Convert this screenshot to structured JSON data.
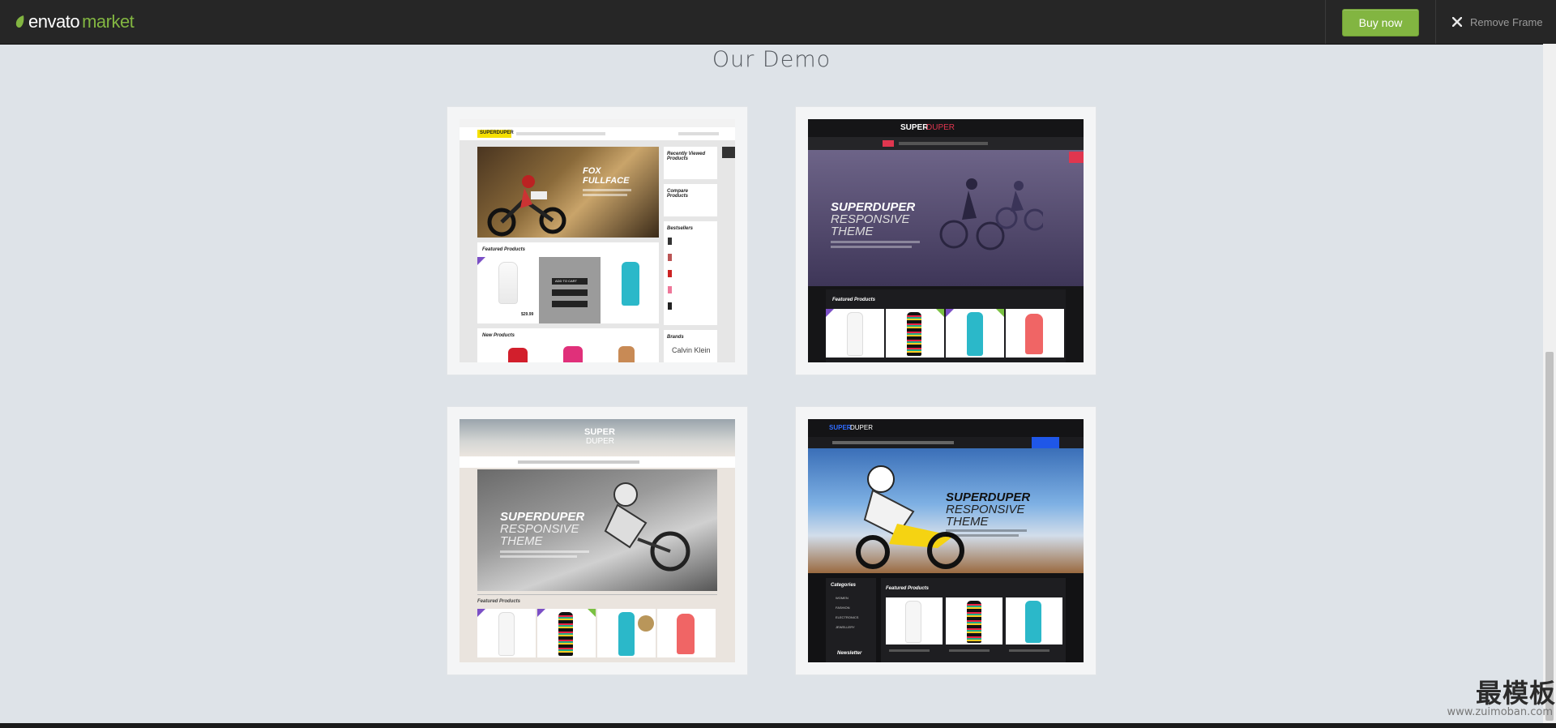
{
  "topbar": {
    "logo_part1": "envato",
    "logo_part2": "market",
    "buy_label": "Buy now",
    "remove_label": "Remove Frame"
  },
  "page": {
    "heading": "Our Demo"
  },
  "demos": [
    {
      "brand": "SUPERDUPER",
      "hero_title_1": "FOX",
      "hero_title_2": "FULLFACE",
      "recently_viewed": "Recently Viewed Products",
      "compare": "Compare Products",
      "bestsellers": "Bestsellers",
      "featured": "Featured Products",
      "new_products": "New Products",
      "brands": "Brands",
      "brand_logo": "Calvin Klein",
      "add_to_cart": "ADD TO CART",
      "price": "$29.99"
    },
    {
      "brand_a": "SUPER",
      "brand_b": "DUPER",
      "hero_1": "SUPERDUPER",
      "hero_2": "RESPONSIVE",
      "hero_3": "THEME",
      "featured": "Featured Products"
    },
    {
      "brand_a": "SUPER",
      "brand_b": "DUPER",
      "hero_1": "SUPERDUPER",
      "hero_2": "RESPONSIVE",
      "hero_3": "THEME",
      "featured": "Featured Products"
    },
    {
      "brand_a": "SUPER",
      "brand_b": "DUPER",
      "hero_1": "SUPERDUPER",
      "hero_2": "RESPONSIVE",
      "hero_3": "THEME",
      "categories": "Categories",
      "featured": "Featured Products",
      "newsletter": "Newsletter",
      "cat_items": [
        "WOMEN",
        "FASHION",
        "ELECTRONICS",
        "JEWELLERY"
      ]
    }
  ],
  "watermark": {
    "line1": "最模板",
    "line2": "www.zuimoban.com"
  },
  "colors": {
    "accent": "#82b541",
    "topbar": "#262626",
    "background": "#dee3e8"
  }
}
